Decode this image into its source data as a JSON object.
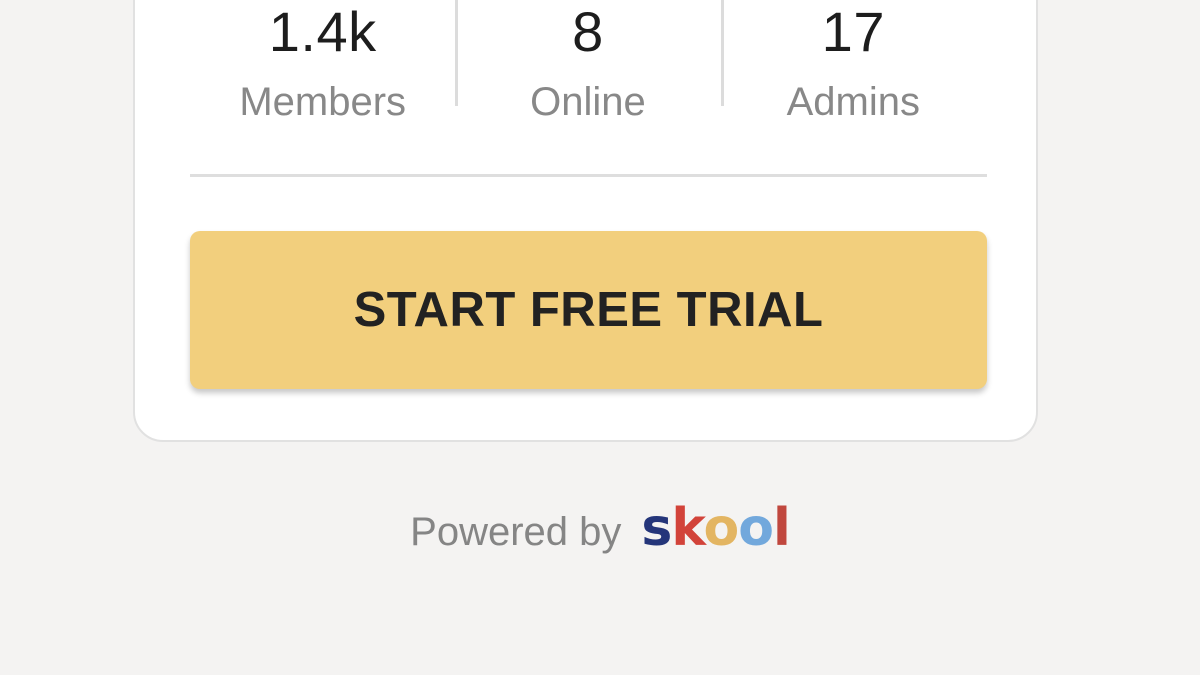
{
  "stats": [
    {
      "value": "1.4k",
      "label": "Members"
    },
    {
      "value": "8",
      "label": "Online"
    },
    {
      "value": "17",
      "label": "Admins"
    }
  ],
  "cta": {
    "label": "START FREE TRIAL",
    "color": "#f2cf7d"
  },
  "footer": {
    "powered_by": "Powered by",
    "logo_text": "skool",
    "logo_letters": [
      "s",
      "k",
      "o",
      "o",
      "l"
    ],
    "logo_colors": [
      "#24357a",
      "#d2433a",
      "#e3b562",
      "#72a8dc",
      "#c0473e"
    ]
  },
  "colors": {
    "background": "#f4f3f2",
    "card": "#ffffff"
  }
}
